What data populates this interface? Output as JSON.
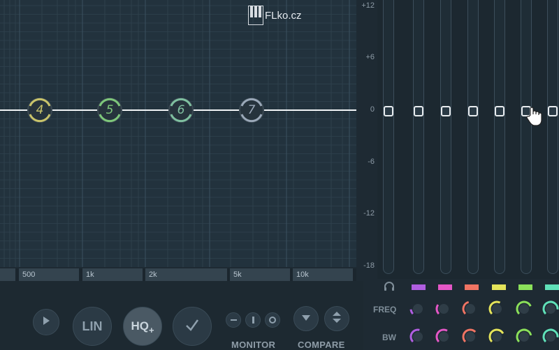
{
  "logo": {
    "text": "FLko.cz"
  },
  "db_scale": [
    "+12",
    "+6",
    "0",
    "-6",
    "-12",
    "-18"
  ],
  "freq_labels": [
    "500",
    "1k",
    "2k",
    "5k",
    "10k"
  ],
  "bands": [
    {
      "label": "4",
      "color": "#c9c46a"
    },
    {
      "label": "5",
      "color": "#7ec77a"
    },
    {
      "label": "6",
      "color": "#7fc0a0"
    },
    {
      "label": "7",
      "color": "#9aa8b8"
    }
  ],
  "fader_colors": [
    "#b05ee0",
    "#e457c6",
    "#f07463",
    "#e5e45a",
    "#8be05a",
    "#60e0b8"
  ],
  "rows": {
    "freq": "FREQ",
    "bw": "BW"
  },
  "buttons": {
    "lin": "LIN",
    "hq": "HQ",
    "hq_sub": "+"
  },
  "sections": {
    "monitor": "MONITOR",
    "compare": "COMPARE"
  },
  "icons": {
    "play": "play-icon",
    "check": "checkmark-icon",
    "headphones": "headphones-icon",
    "compare_down": "triangle-down-icon",
    "compare_swap": "swap-arrows-icon"
  }
}
